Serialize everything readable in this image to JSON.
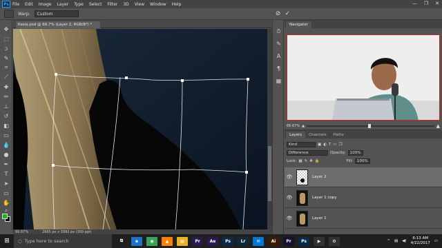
{
  "app": {
    "logo": "Ps"
  },
  "menu": [
    "File",
    "Edit",
    "Image",
    "Layer",
    "Type",
    "Select",
    "Filter",
    "3D",
    "View",
    "Window",
    "Help"
  ],
  "window_controls": [
    "—",
    "❐",
    "✕"
  ],
  "options_bar": {
    "warp_label": "Warp:",
    "warp_value": "Custom",
    "cancel_icon": "⊘",
    "commit_icon": "✓"
  },
  "document": {
    "tab_title": "Kasia.psd @ 66.7% (Layer 2, RGB/8*) *",
    "status_zoom": "66.67%",
    "status_doc": "2665 px x 3992 px (300 ppi)"
  },
  "navigator": {
    "tab": "Navigator",
    "zoom": "66.67%"
  },
  "layers": {
    "tabs": [
      "Layers",
      "Channels",
      "Paths"
    ],
    "kind_label": "Kind",
    "blend_mode": "Difference",
    "opacity_label": "Opacity:",
    "opacity_value": "100%",
    "lock_label": "Lock:",
    "fill_label": "Fill:",
    "fill_value": "100%",
    "items": [
      {
        "name": "Layer 2",
        "selected": true
      },
      {
        "name": "Layer 1 copy",
        "selected": false
      },
      {
        "name": "Layer 1",
        "selected": false
      }
    ]
  },
  "taskbar": {
    "search_placeholder": "Type here to search",
    "time": "6:13 AM",
    "date": "4/22/2017",
    "apps": [
      {
        "label": "⧉",
        "color": "#1f1f1f"
      },
      {
        "label": "e",
        "color": "#1e73c8"
      },
      {
        "label": "◉",
        "color": "#3aa35a"
      },
      {
        "label": "▲",
        "color": "#ff7f00"
      },
      {
        "label": "▤",
        "color": "#e8b32a"
      },
      {
        "label": "Pr",
        "color": "#2b1a4d"
      },
      {
        "label": "Ae",
        "color": "#2b1a4d"
      },
      {
        "label": "Ps",
        "color": "#0a2a4a"
      },
      {
        "label": "Lr",
        "color": "#0f2a3c"
      },
      {
        "label": "✉",
        "color": "#0078d7"
      },
      {
        "label": "Ai",
        "color": "#3a1c00"
      },
      {
        "label": "Pr",
        "color": "#1a1030"
      },
      {
        "label": "Ps",
        "color": "#0a2a4a"
      },
      {
        "label": "▶",
        "color": "#333333"
      },
      {
        "label": "⚙",
        "color": "#333333"
      }
    ]
  }
}
